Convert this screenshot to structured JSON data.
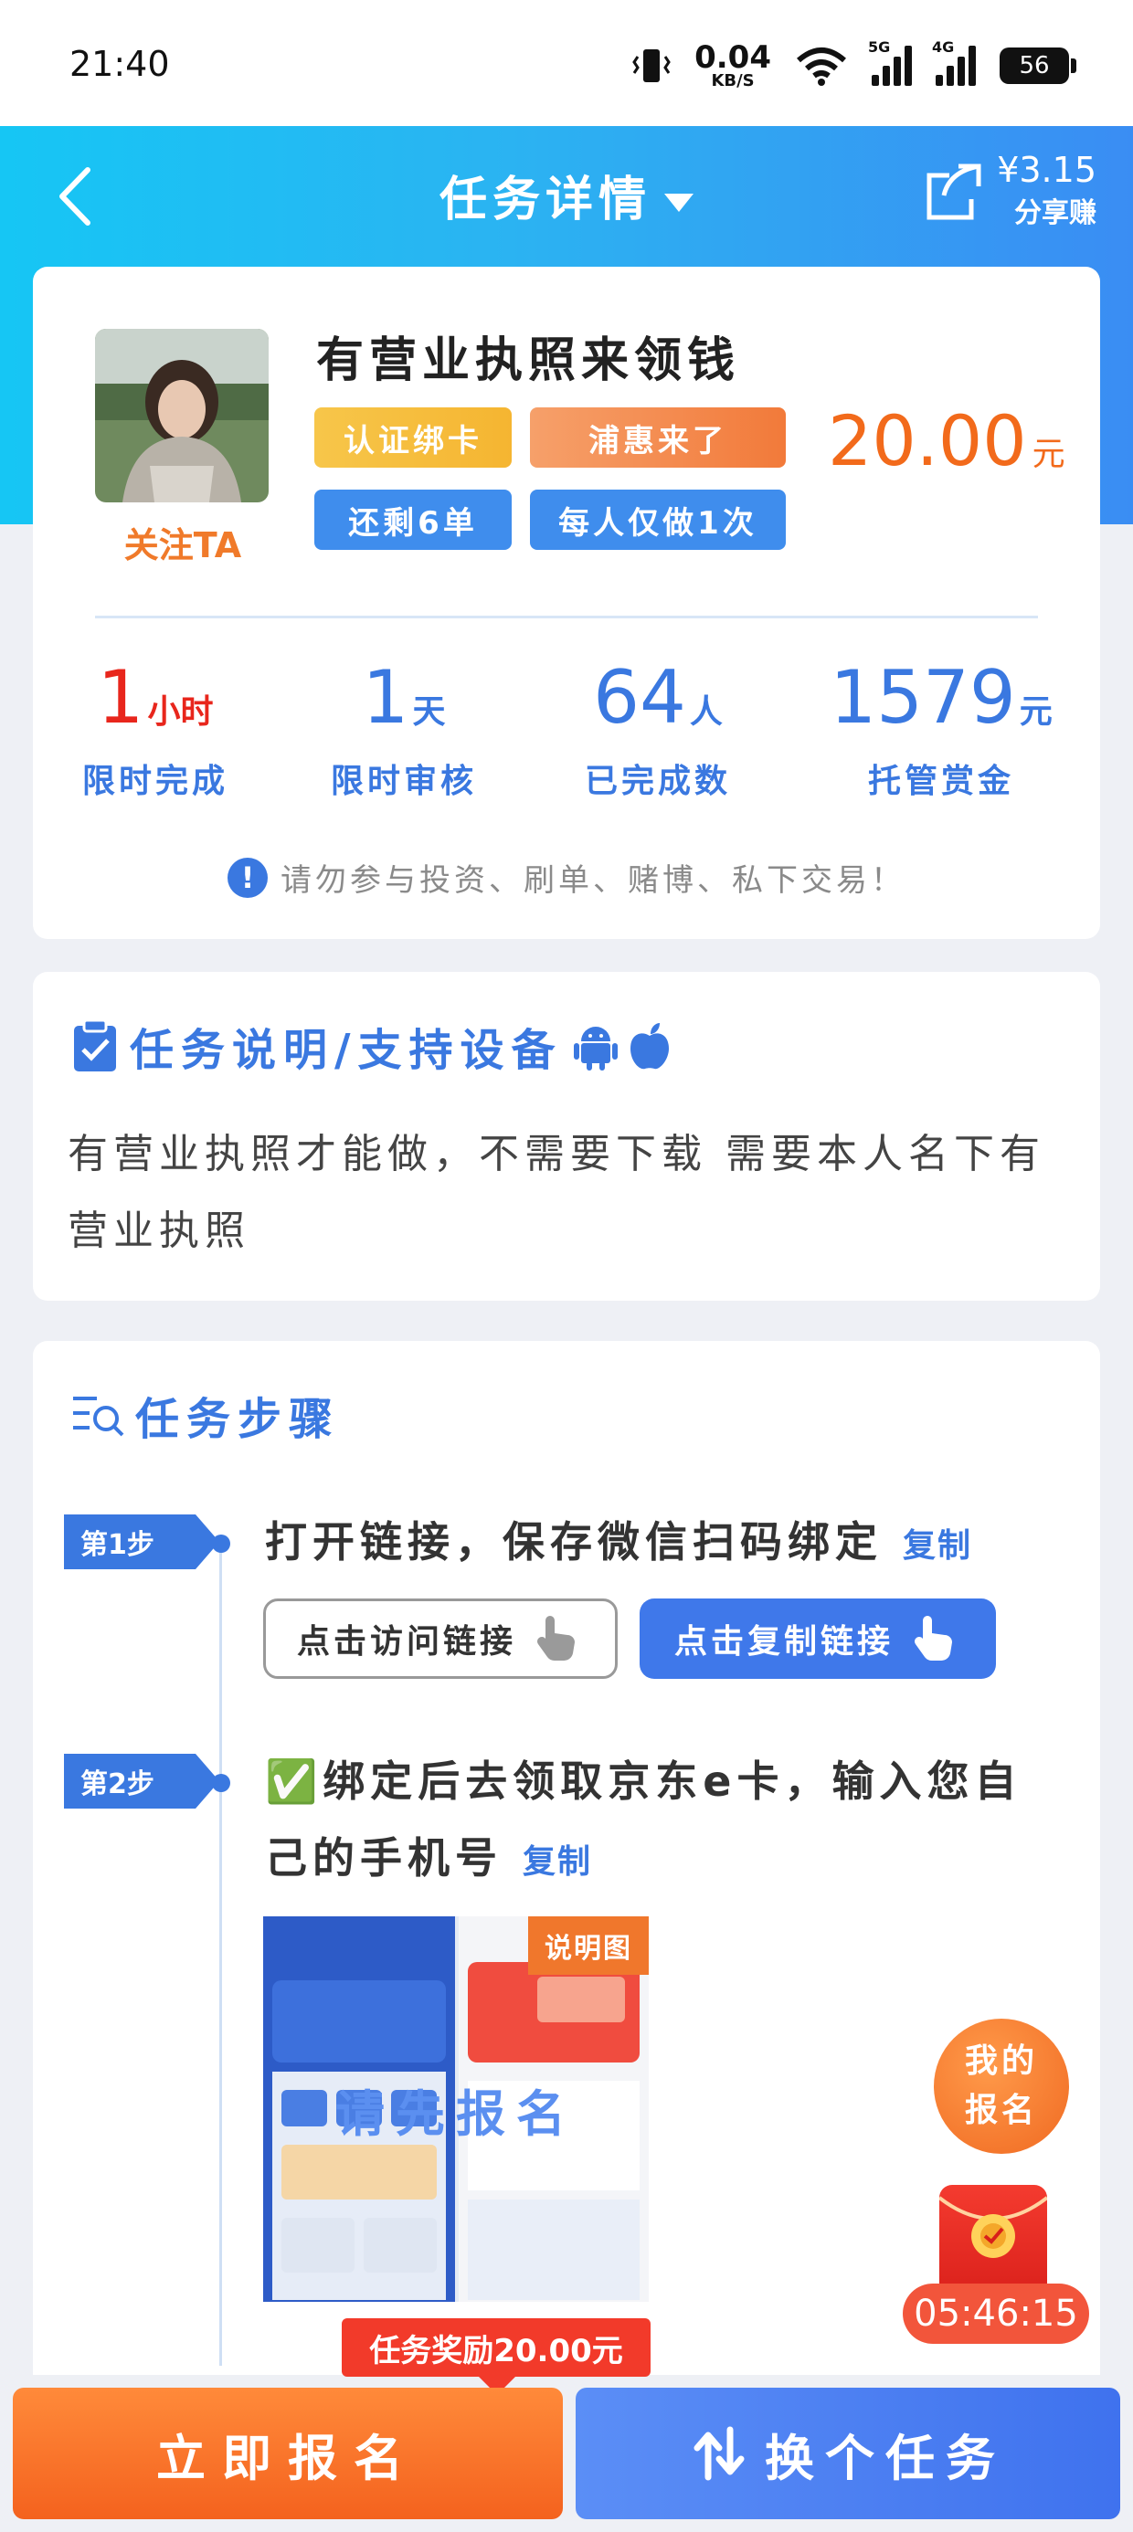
{
  "status_bar": {
    "time": "21:40",
    "net_speed": "0.04",
    "net_unit": "KB/S",
    "sig1": "5G",
    "sig2": "4G",
    "battery": "56"
  },
  "header": {
    "title": "任务详情",
    "share_amount": "¥3.15",
    "share_label": "分享赚"
  },
  "task": {
    "name": "有营业执照来领钱",
    "follow": "关注TA",
    "tags": [
      "认证绑卡",
      "浦惠来了",
      "还剩6单",
      "每人仅做1次"
    ],
    "reward": "20.00",
    "reward_unit": "元",
    "stats": [
      {
        "value": "1",
        "unit": "小时",
        "label": "限时完成"
      },
      {
        "value": "1",
        "unit": "天",
        "label": "限时审核"
      },
      {
        "value": "64",
        "unit": "人",
        "label": "已完成数"
      },
      {
        "value": "1579",
        "unit": "元",
        "label": "托管赏金"
      }
    ],
    "warning": "请勿参与投资、刷单、赌博、私下交易！"
  },
  "description": {
    "title": "任务说明/支持设备",
    "text": "有营业执照才能做，不需要下载 需要本人名下有营业执照"
  },
  "steps": {
    "title": "任务步骤",
    "copy_label": "复制",
    "items": [
      {
        "badge": "第1步",
        "text": "打开链接，保存微信扫码绑定"
      },
      {
        "badge": "第2步",
        "text_line1": "✅绑定后去领取京东e卡，输入您自",
        "text_line2": "己的手机号"
      }
    ],
    "visit_button": "点击访问链接",
    "copy_button": "点击复制链接",
    "image_label": "说明图",
    "image_overlay": "请先报名"
  },
  "floating": {
    "mine": "我的报名",
    "timer": "05:46:15"
  },
  "footer": {
    "reward_badge": "任务奖励20.00元",
    "signup": "立即报名",
    "switch": "换个任务"
  },
  "colors": {
    "primary": "#3a78e0",
    "orange": "#f26a1b",
    "red": "#e8261c"
  }
}
